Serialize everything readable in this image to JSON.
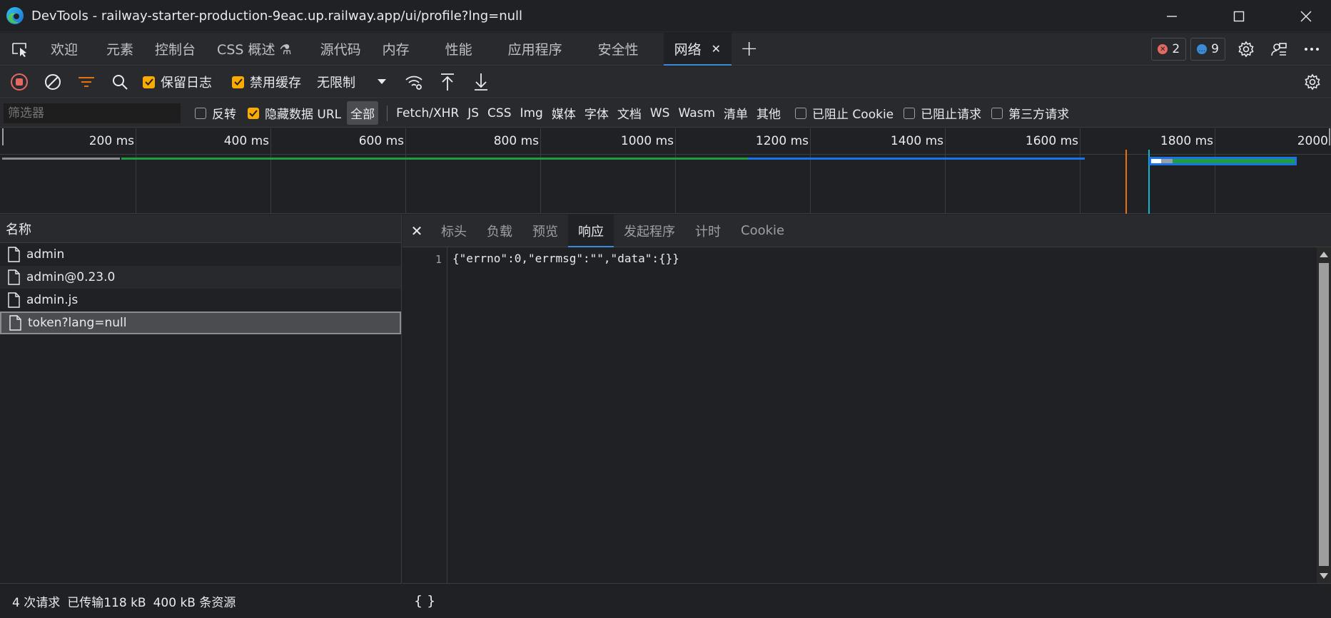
{
  "window": {
    "title": "DevTools - railway-starter-production-9eac.up.railway.app/ui/profile?lng=null"
  },
  "tabs": [
    {
      "label": "欢迎"
    },
    {
      "label": "元素"
    },
    {
      "label": "控制台"
    },
    {
      "label": "CSS 概述 ⚗"
    },
    {
      "label": "源代码"
    },
    {
      "label": "内存"
    },
    {
      "label": "性能"
    },
    {
      "label": "应用程序"
    },
    {
      "label": "安全性"
    },
    {
      "label": "网络",
      "active": true
    }
  ],
  "badges": {
    "errors": "2",
    "messages": "9",
    "error_color": "#e46962",
    "message_color": "#3b8bd9"
  },
  "toolbar": {
    "preserve_log": "保留日志",
    "disable_cache": "禁用缓存",
    "throttle": "无限制"
  },
  "filter": {
    "placeholder": "筛选器",
    "invert": "反转",
    "hide_data_urls": "隐藏数据 URL",
    "types": [
      "全部",
      "Fetch/XHR",
      "JS",
      "CSS",
      "Img",
      "媒体",
      "字体",
      "文档",
      "WS",
      "Wasm",
      "清单",
      "其他"
    ],
    "blocked_cookies": "已阻止 Cookie",
    "blocked_requests": "已阻止请求",
    "third_party": "第三方请求"
  },
  "overview": {
    "ticks": [
      "200 ms",
      "400 ms",
      "600 ms",
      "800 ms",
      "1000 ms",
      "1200 ms",
      "1400 ms",
      "1600 ms",
      "1800 ms",
      "2000"
    ]
  },
  "requests": {
    "column_name": "名称",
    "items": [
      {
        "name": "admin"
      },
      {
        "name": "admin@0.23.0"
      },
      {
        "name": "admin.js"
      },
      {
        "name": "token?lang=null",
        "selected": true
      }
    ],
    "summary": {
      "count": "4 次请求",
      "transferred": "已传输118 kB",
      "resources": "400 kB 条资源"
    }
  },
  "details": {
    "tabs": [
      "标头",
      "负载",
      "预览",
      "响应",
      "发起程序",
      "计时",
      "Cookie"
    ],
    "active_tab": "响应",
    "line_number": "1",
    "response_text": "{\"errno\":0,\"errmsg\":\"\",\"data\":{}}",
    "format_button": "{ }"
  }
}
